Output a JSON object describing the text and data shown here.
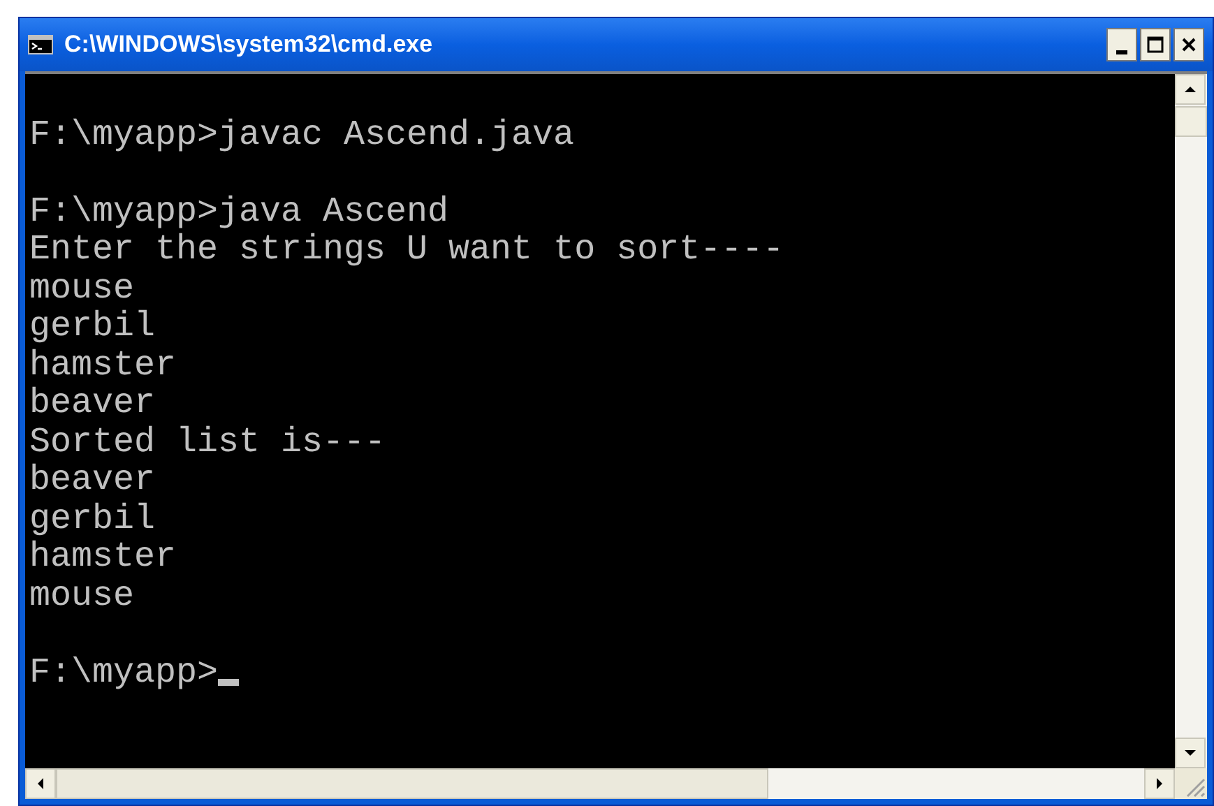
{
  "window": {
    "title": "C:\\WINDOWS\\system32\\cmd.exe"
  },
  "console": {
    "lines": [
      {
        "kind": "blank"
      },
      {
        "kind": "text",
        "text": "F:\\myapp>javac Ascend.java"
      },
      {
        "kind": "blank"
      },
      {
        "kind": "text",
        "text": "F:\\myapp>java Ascend"
      },
      {
        "kind": "text",
        "text": "Enter the strings U want to sort----"
      },
      {
        "kind": "text",
        "text": "mouse"
      },
      {
        "kind": "text",
        "text": "gerbil"
      },
      {
        "kind": "text",
        "text": "hamster"
      },
      {
        "kind": "text",
        "text": "beaver"
      },
      {
        "kind": "text",
        "text": "Sorted list is---"
      },
      {
        "kind": "text",
        "text": "beaver"
      },
      {
        "kind": "text",
        "text": "gerbil"
      },
      {
        "kind": "text",
        "text": "hamster"
      },
      {
        "kind": "text",
        "text": "mouse"
      },
      {
        "kind": "blank"
      },
      {
        "kind": "prompt",
        "text": "F:\\myapp>"
      }
    ]
  }
}
